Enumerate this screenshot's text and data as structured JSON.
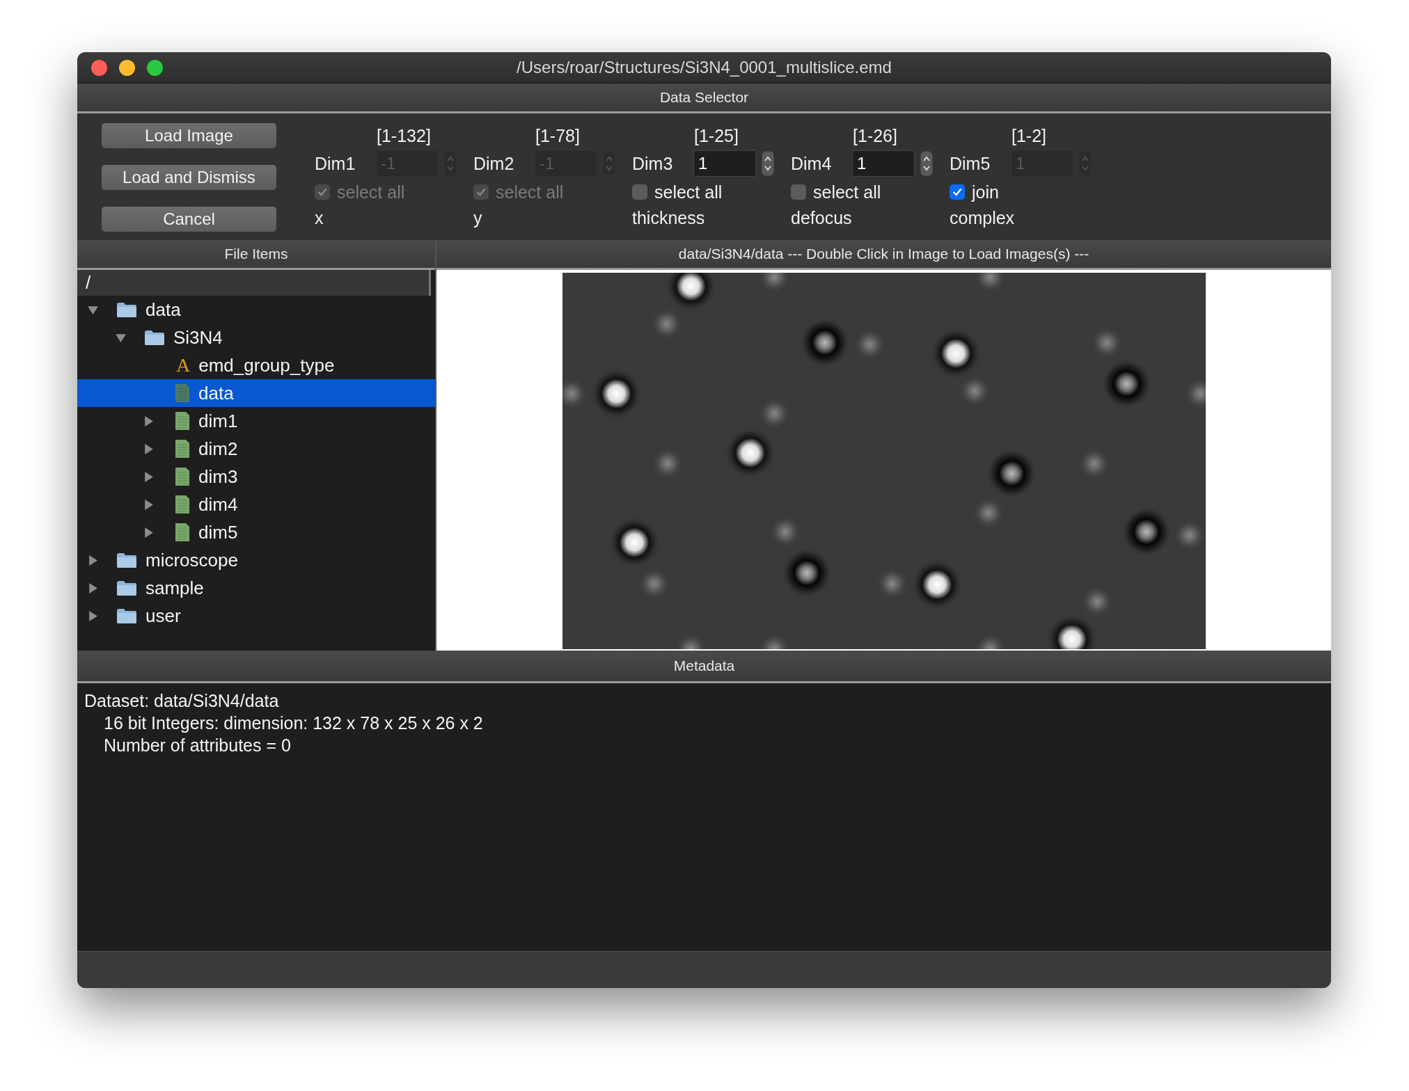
{
  "window": {
    "title": "/Users/roar/Structures/Si3N4_0001_multislice.emd"
  },
  "data_selector": {
    "title": "Data Selector",
    "buttons": [
      "Load Image",
      "Load and Dismiss",
      "Cancel"
    ],
    "dims": [
      {
        "label": "Dim1",
        "range": "[1-132]",
        "value": "-1",
        "disabled": true,
        "select_label": "select all",
        "checked": true,
        "check_disabled": true,
        "caption": "x"
      },
      {
        "label": "Dim2",
        "range": "[1-78]",
        "value": "-1",
        "disabled": true,
        "select_label": "select all",
        "checked": true,
        "check_disabled": true,
        "caption": "y"
      },
      {
        "label": "Dim3",
        "range": "[1-25]",
        "value": "1",
        "disabled": false,
        "select_label": "select all",
        "checked": false,
        "check_disabled": false,
        "caption": "thickness"
      },
      {
        "label": "Dim4",
        "range": "[1-26]",
        "value": "1",
        "disabled": false,
        "select_label": "select all",
        "checked": false,
        "check_disabled": false,
        "caption": "defocus"
      },
      {
        "label": "Dim5",
        "range": "[1-2]",
        "value": "1",
        "disabled": true,
        "select_label": "join",
        "checked": true,
        "check_disabled": false,
        "caption": "complex"
      }
    ]
  },
  "file_items": {
    "title": "File Items",
    "path": "/",
    "tree": [
      {
        "kind": "folder",
        "label": "data",
        "expanded": true,
        "selected": false,
        "children": [
          {
            "kind": "folder",
            "label": "Si3N4",
            "expanded": true,
            "selected": false,
            "children": [
              {
                "kind": "attribute",
                "icon": "A",
                "label": "emd_group_type",
                "selected": false
              },
              {
                "kind": "dataset",
                "label": "data",
                "selected": true
              },
              {
                "kind": "dataset",
                "label": "dim1",
                "expanded": false,
                "selected": false
              },
              {
                "kind": "dataset",
                "label": "dim2",
                "expanded": false,
                "selected": false
              },
              {
                "kind": "dataset",
                "label": "dim3",
                "expanded": false,
                "selected": false
              },
              {
                "kind": "dataset",
                "label": "dim4",
                "expanded": false,
                "selected": false
              },
              {
                "kind": "dataset",
                "label": "dim5",
                "expanded": false,
                "selected": false
              }
            ]
          }
        ]
      },
      {
        "kind": "folder",
        "label": "microscope",
        "expanded": false,
        "selected": false
      },
      {
        "kind": "folder",
        "label": "sample",
        "expanded": false,
        "selected": false
      },
      {
        "kind": "folder",
        "label": "user",
        "expanded": false,
        "selected": false
      }
    ]
  },
  "image_panel": {
    "title": "data/Si3N4/data --- Double Click in Image to Load Images(s) ---"
  },
  "metadata": {
    "title": "Metadata",
    "lines": [
      {
        "kind": "heading",
        "text": "Dataset: data/Si3N4/data"
      },
      {
        "kind": "detail",
        "text": "16 bit Integers: dimension: 132 x 78 x 25 x 26 x 2"
      },
      {
        "kind": "detail",
        "text": "Number of attributes = 0"
      }
    ]
  }
}
